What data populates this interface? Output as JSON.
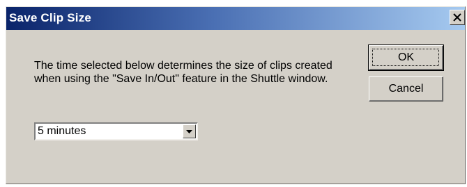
{
  "window": {
    "title": "Save Clip Size",
    "close_label": "×"
  },
  "message": {
    "text": "The time selected below determines the size of clips created when using the \"Save In/Out\" feature in the Shuttle window."
  },
  "duration_select": {
    "selected": "5 minutes"
  },
  "buttons": {
    "ok_label": "OK",
    "cancel_label": "Cancel"
  },
  "colors": {
    "titlebar_start": "#0a246a",
    "titlebar_end": "#a6caf0",
    "dialog_face": "#d4d0c8"
  },
  "icons": {
    "close": "close-icon",
    "dropdown": "chevron-down-icon"
  }
}
